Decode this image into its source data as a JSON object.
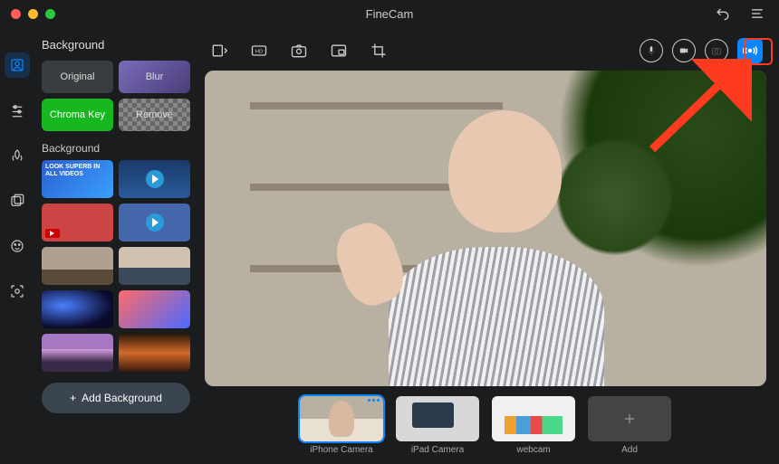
{
  "app": {
    "title": "FineCam"
  },
  "panel": {
    "title": "Background",
    "buttons": {
      "original": "Original",
      "blur": "Blur",
      "chroma": "Chroma Key",
      "remove": "Remove"
    },
    "section_label": "Background",
    "add_button": "Add Background"
  },
  "sources": {
    "items": [
      {
        "label": "iPhone Camera",
        "selected": true
      },
      {
        "label": "iPad Camera",
        "selected": false
      },
      {
        "label": "webcam",
        "selected": false
      },
      {
        "label": "Add",
        "selected": false
      }
    ]
  },
  "icons": {
    "background": "background-icon",
    "sliders": "sliders-icon",
    "effects": "effects-icon",
    "overlay": "overlay-icon",
    "face": "face-icon",
    "focus": "focus-icon",
    "expand": "expand-icon",
    "hd": "hd-icon",
    "snapshot": "camera-icon",
    "pip": "pip-icon",
    "crop": "crop-icon",
    "mic": "mic-icon",
    "record": "record-icon",
    "photo": "photo-icon",
    "broadcast": "broadcast-icon",
    "undo": "undo-icon",
    "menu": "menu-icon",
    "plus": "plus-icon"
  }
}
